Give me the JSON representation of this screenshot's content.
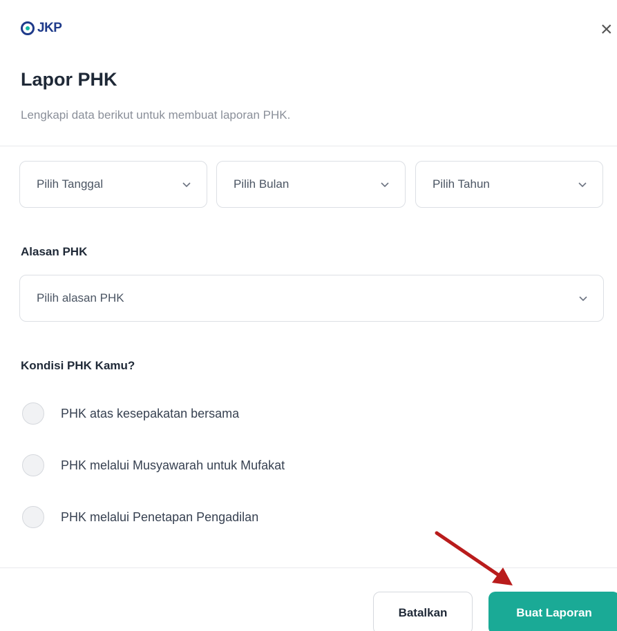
{
  "brand": {
    "name": "JKP"
  },
  "dialog": {
    "title": "Lapor PHK",
    "subtitle": "Lengkapi data berikut untuk membuat laporan PHK.",
    "close_icon": "close-icon"
  },
  "date_selects": {
    "day": {
      "placeholder": "Pilih Tanggal"
    },
    "month": {
      "placeholder": "Pilih Bulan"
    },
    "year": {
      "placeholder": "Pilih Tahun"
    }
  },
  "reason": {
    "label": "Alasan PHK",
    "placeholder": "Pilih alasan PHK"
  },
  "condition": {
    "label": "Kondisi PHK Kamu?",
    "options": [
      "PHK atas kesepakatan bersama",
      "PHK melalui Musyawarah untuk Mufakat",
      "PHK melalui Penetapan Pengadilan"
    ]
  },
  "actions": {
    "cancel_label": "Batalkan",
    "submit_label": "Buat Laporan"
  },
  "colors": {
    "brand_blue": "#1e3a8a",
    "accent_teal": "#1aaa96",
    "annotation_arrow": "#b91c1c"
  }
}
